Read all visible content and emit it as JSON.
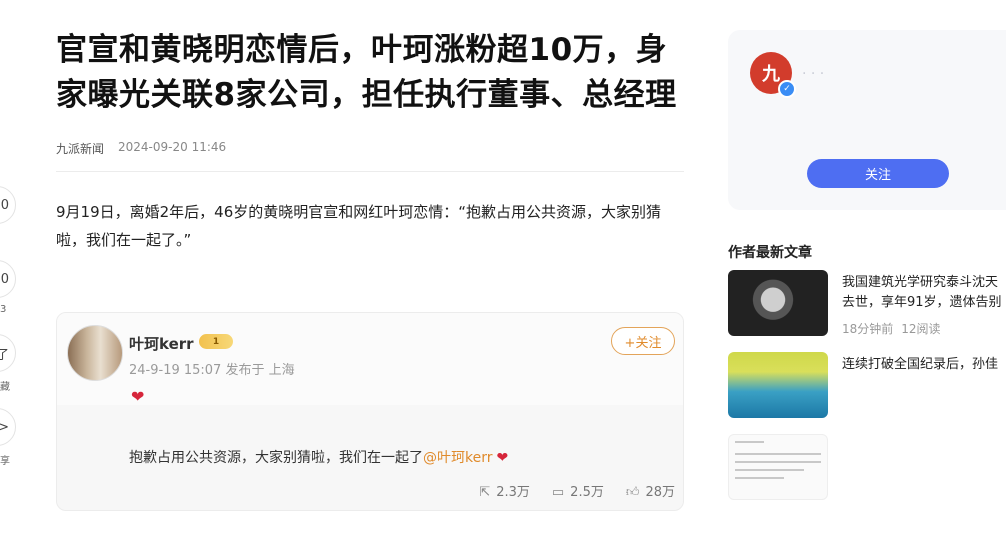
{
  "rail": {
    "items": [
      {
        "icon": "like-icon",
        "glyph": "0",
        "count": ""
      },
      {
        "icon": "comment-icon",
        "glyph": "0",
        "count": "3"
      },
      {
        "icon": "favorite-icon",
        "glyph": "了",
        "count": "藏"
      },
      {
        "icon": "share-icon",
        "glyph": ">",
        "count": "享"
      }
    ]
  },
  "article": {
    "title": "官宣和黄晓明恋情后，叶珂涨粉超10万，身家曝光关联8家公司，担任执行董事、总经理",
    "source": "九派新闻",
    "date": "2024-09-20 11:46",
    "paragraph": "9月19日，离婚2年后，46岁的黄晓明官宣和网红叶珂恋情：“抱歉占用公共资源，大家别猜啦，我们在一起了。”"
  },
  "post": {
    "username": "叶珂kerr",
    "vip_badge": "1",
    "time": "24-9-19 15:07 发布于 上海",
    "follow_label": "+关注",
    "text": "抱歉占用公共资源，大家别猜啦，我们在一起了",
    "mention": "@叶珂kerr",
    "reposts": "2.3万",
    "comments": "2.5万",
    "likes": "28万"
  },
  "author": {
    "avatar_text": "九",
    "follow_label": "关注"
  },
  "sidebar": {
    "section_title": "作者最新文章",
    "articles": [
      {
        "title_line1": "我国建筑光学研究泰斗沈天",
        "title_line2": "去世，享年91岁，遗体告别",
        "time": "18分钟前",
        "reads": "12阅读"
      },
      {
        "title_line1": "连续打破全国纪录后，孙佳",
        "title_line2": "",
        "time": "",
        "reads": ""
      },
      {
        "title_line1": "",
        "title_line2": "",
        "time": "",
        "reads": ""
      }
    ]
  },
  "colors": {
    "accent_blue": "#4e6ef2",
    "weibo_orange": "#e08b2c",
    "heart_red": "#d6263b"
  }
}
